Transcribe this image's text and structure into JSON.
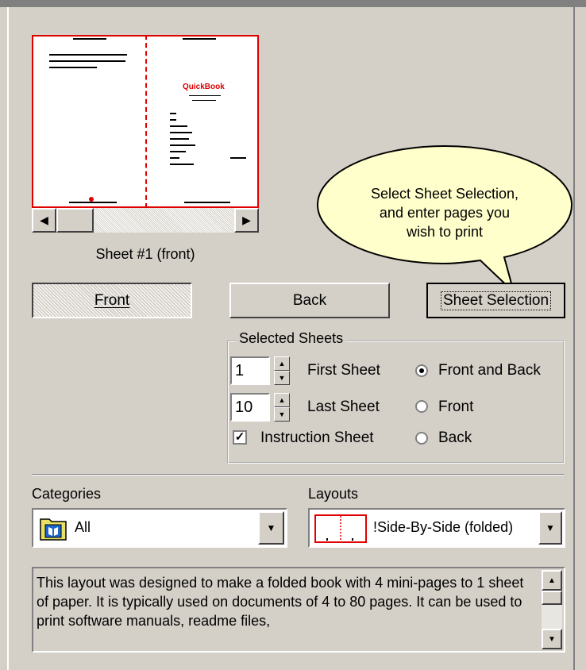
{
  "preview": {
    "brand_logo_text": "QuickBook",
    "sheet_caption": "Sheet #1 (front)"
  },
  "buttons": {
    "front": "Front",
    "back": "Back",
    "sheet_selection": "Sheet Selection"
  },
  "callout": {
    "lines": [
      "Select Sheet Selection,",
      "and enter pages  you",
      "wish to print"
    ]
  },
  "selected_sheets": {
    "title": "Selected Sheets",
    "first_sheet_value": "1",
    "first_sheet_label": "First Sheet",
    "last_sheet_value": "10",
    "last_sheet_label": "Last Sheet",
    "instruction_sheet_label": "Instruction Sheet",
    "instruction_sheet_checked": true,
    "radio_front_and_back": "Front and Back",
    "radio_front": "Front",
    "radio_back": "Back",
    "selected_radio": "Front and Back"
  },
  "categories": {
    "label": "Categories",
    "value": "All",
    "icon": "book-folder-icon"
  },
  "layouts": {
    "label": "Layouts",
    "value": "!Side-By-Side (folded)",
    "icon": "side-by-side-layout-icon"
  },
  "description": {
    "text": "This layout was designed to make a folded book with 4 mini-pages to 1 sheet of paper. It is typically used on documents of 4 to 80 pages.  It can be used to print software manuals, readme files,"
  },
  "colors": {
    "window_bg": "#d4d0c8",
    "preview_border": "#e00000",
    "callout_fill": "#ffffcc"
  }
}
